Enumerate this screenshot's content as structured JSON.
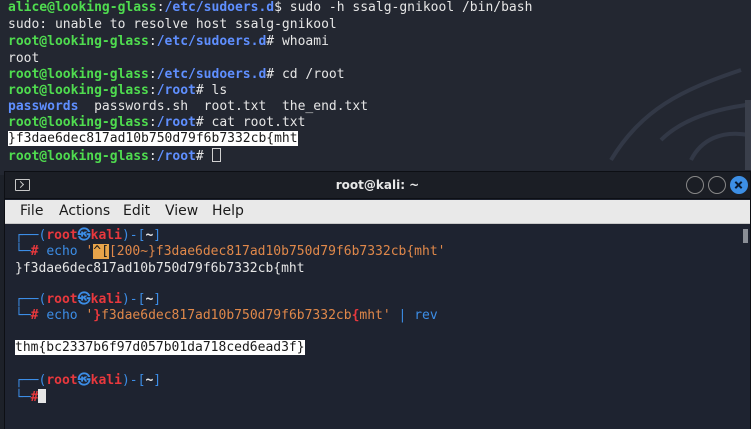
{
  "background_terminal": {
    "lines": [
      {
        "user_host": "alice@looking-glass",
        "path": "/etc/sudoers.d",
        "sym": "$",
        "cmd": " sudo -h ssalg-gnikool /bin/bash"
      },
      {
        "text": "sudo: unable to resolve host ssalg-gnikool"
      },
      {
        "user_host": "root@looking-glass",
        "path": "/etc/sudoers.d",
        "sym": "#",
        "cmd": " whoami"
      },
      {
        "text": "root"
      },
      {
        "user_host": "root@looking-glass",
        "path": "/etc/sudoers.d",
        "sym": "#",
        "cmd": " cd /root"
      },
      {
        "user_host": "root@looking-glass",
        "path": "/root",
        "sym": "#",
        "cmd": " ls"
      },
      {
        "ls_dir": "passwords",
        "ls_rest": "  passwords.sh  root.txt  the_end.txt"
      },
      {
        "user_host": "root@looking-glass",
        "path": "/root",
        "sym": "#",
        "cmd": " cat root.txt"
      },
      {
        "selected": "}f3dae6dec817ad10b750d79f6b7332cb{mht"
      },
      {
        "user_host": "root@looking-glass",
        "path": "/root",
        "sym": "#",
        "cmd": " "
      }
    ]
  },
  "window": {
    "title": "root@kali: ~",
    "menu": [
      "File",
      "Actions",
      "Edit",
      "View",
      "Help"
    ]
  },
  "terminal": {
    "prompt": {
      "open": "┌──(",
      "user": "root",
      "skull": "㉿",
      "host": "kali",
      "mid": ")-[",
      "dir": "~",
      "close": "]",
      "bottom": "└─",
      "sym": "#"
    },
    "cmd1": {
      "echo": "echo",
      "q1": "'",
      "hl": "^[",
      "rest": "[200~}f3dae6dec817ad10b750d79f6b7332cb{mht",
      "q2": "'"
    },
    "out1": "}f3dae6dec817ad10b750d79f6b7332cb{mht",
    "cmd2": {
      "echo": "echo",
      "q1": "'",
      "b1": "}",
      "mid": "f3dae6dec817ad10b750d79f6b7332cb",
      "b2": "{",
      "tail": "mht",
      "q2": "'",
      "pipe": "|",
      "rev": "rev"
    },
    "out2": "thm{bc2337b6f97d057b01da718ced6ead3f}"
  }
}
